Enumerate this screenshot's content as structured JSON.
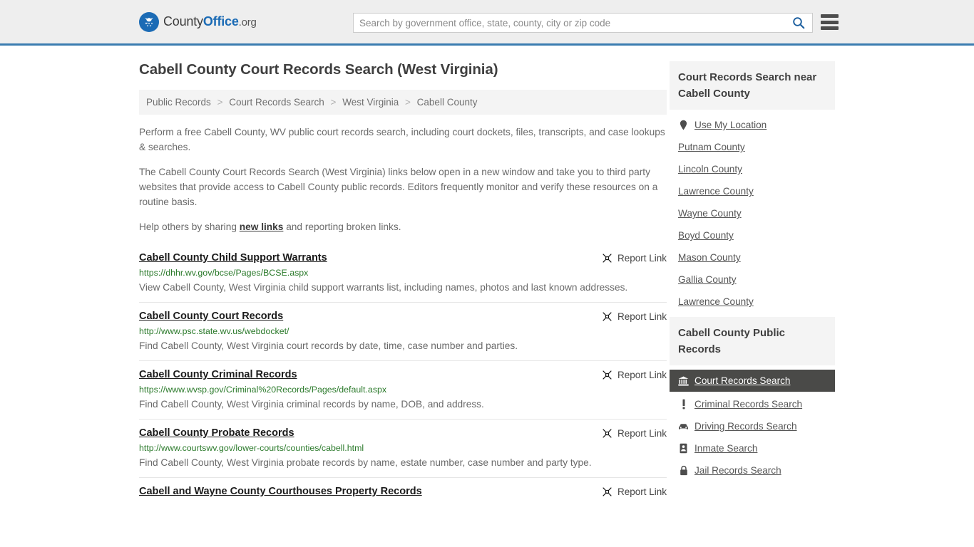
{
  "header": {
    "logo": {
      "name_part1": "County",
      "name_part2": "Office",
      "name_part3": ".org",
      "icon": "eagle-seal-icon"
    },
    "search": {
      "placeholder": "Search by government office, state, county, city or zip code",
      "value": "",
      "icon": "search-icon"
    },
    "menu_icon": "hamburger-menu-icon",
    "accent_color": "#3b7cb0",
    "background_color": "#eeeeee"
  },
  "page_title": "Cabell County Court Records Search (West Virginia)",
  "breadcrumb": {
    "separator": ">",
    "items": [
      {
        "label": "Public Records"
      },
      {
        "label": "Court Records Search"
      },
      {
        "label": "West Virginia"
      },
      {
        "label": "Cabell County"
      }
    ]
  },
  "intro": {
    "paragraph1": "Perform a free Cabell County, WV public court records search, including court dockets, files, transcripts, and case lookups & searches.",
    "paragraph2": "The Cabell County Court Records Search (West Virginia) links below open in a new window and take you to third party websites that provide access to Cabell County public records. Editors frequently monitor and verify these resources on a routine basis.",
    "paragraph3_before": "Help others by sharing ",
    "paragraph3_link": "new links",
    "paragraph3_after": " and reporting broken links."
  },
  "report_link": {
    "label": "Report Link",
    "icon": "broken-link-icon"
  },
  "results": [
    {
      "title": "Cabell County Child Support Warrants",
      "url": "https://dhhr.wv.gov/bcse/Pages/BCSE.aspx",
      "description": "View Cabell County, West Virginia child support warrants list, including names, photos and last known addresses."
    },
    {
      "title": "Cabell County Court Records",
      "url": "http://www.psc.state.wv.us/webdocket/",
      "description": "Find Cabell County, West Virginia court records by date, time, case number and parties."
    },
    {
      "title": "Cabell County Criminal Records",
      "url": "https://www.wvsp.gov/Criminal%20Records/Pages/default.aspx",
      "description": "Find Cabell County, West Virginia criminal records by name, DOB, and address."
    },
    {
      "title": "Cabell County Probate Records",
      "url": "http://www.courtswv.gov/lower-courts/counties/cabell.html",
      "description": "Find Cabell County, West Virginia probate records by name, estate number, case number and party type."
    },
    {
      "title": "Cabell and Wayne County Courthouses Property Records",
      "url": "",
      "description": ""
    }
  ],
  "sidebar": {
    "nearby": {
      "heading": "Court Records Search near Cabell County",
      "use_my_location": {
        "label": "Use My Location",
        "icon": "map-pin-icon"
      },
      "counties": [
        {
          "label": "Putnam County"
        },
        {
          "label": "Lincoln County"
        },
        {
          "label": "Lawrence County"
        },
        {
          "label": "Wayne County"
        },
        {
          "label": "Boyd County"
        },
        {
          "label": "Mason County"
        },
        {
          "label": "Gallia County"
        },
        {
          "label": "Lawrence County"
        }
      ]
    },
    "public_records": {
      "heading": "Cabell County Public Records",
      "active_color": "#4a4a48",
      "items": [
        {
          "label": "Court Records Search",
          "icon": "courthouse-icon",
          "active": true
        },
        {
          "label": "Criminal Records Search",
          "icon": "exclamation-icon",
          "active": false
        },
        {
          "label": "Driving Records Search",
          "icon": "car-icon",
          "active": false
        },
        {
          "label": "Inmate Search",
          "icon": "id-card-icon",
          "active": false
        },
        {
          "label": "Jail Records Search",
          "icon": "lock-icon",
          "active": false
        }
      ]
    }
  }
}
